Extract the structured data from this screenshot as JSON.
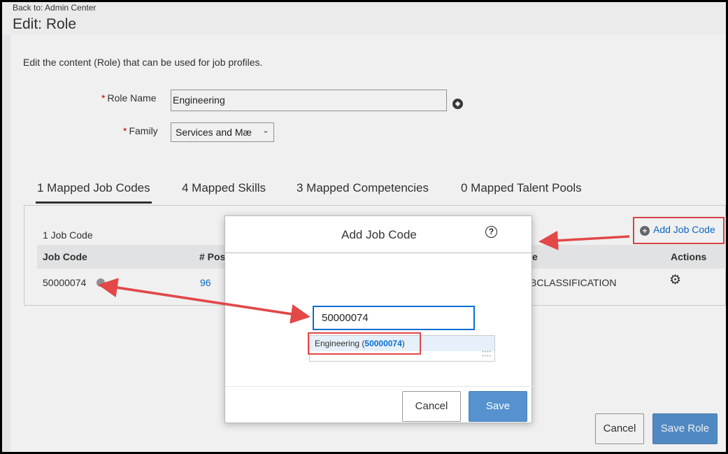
{
  "header": {
    "back_link": "Back to: Admin Center",
    "title": "Edit: Role"
  },
  "description": "Edit the content (Role) that can be used for job profiles.",
  "form": {
    "role_name_label": "Role Name",
    "role_name_value": "Engineering",
    "family_label": "Family",
    "family_value": "Services and Mæ",
    "required_mark": "*"
  },
  "tabs": [
    {
      "label": "1 Mapped Job Codes",
      "active": true
    },
    {
      "label": "4 Mapped Skills",
      "active": false
    },
    {
      "label": "3 Mapped Competencies",
      "active": false
    },
    {
      "label": "0 Mapped Talent Pools",
      "active": false
    }
  ],
  "job_codes": {
    "count_text": "1 Job Code",
    "add_link": "Add Job Code",
    "columns": [
      "Job Code",
      "# Pos",
      "e",
      "Actions"
    ],
    "rows": [
      {
        "job_code": "50000074",
        "positions": "96",
        "classification": "BCLASSIFICATION"
      }
    ]
  },
  "footer": {
    "cancel": "Cancel",
    "save_role": "Save Role"
  },
  "dialog": {
    "title": "Add Job Code",
    "help": "?",
    "input_value": "50000074",
    "suggestion_name": "Engineering (",
    "suggestion_code": "50000074",
    "suggestion_close": ")",
    "cancel": "Cancel",
    "save": "Save"
  },
  "colors": {
    "accent": "#0a6ed1",
    "primary_button": "#5592cf",
    "annotation": "#e24848"
  }
}
